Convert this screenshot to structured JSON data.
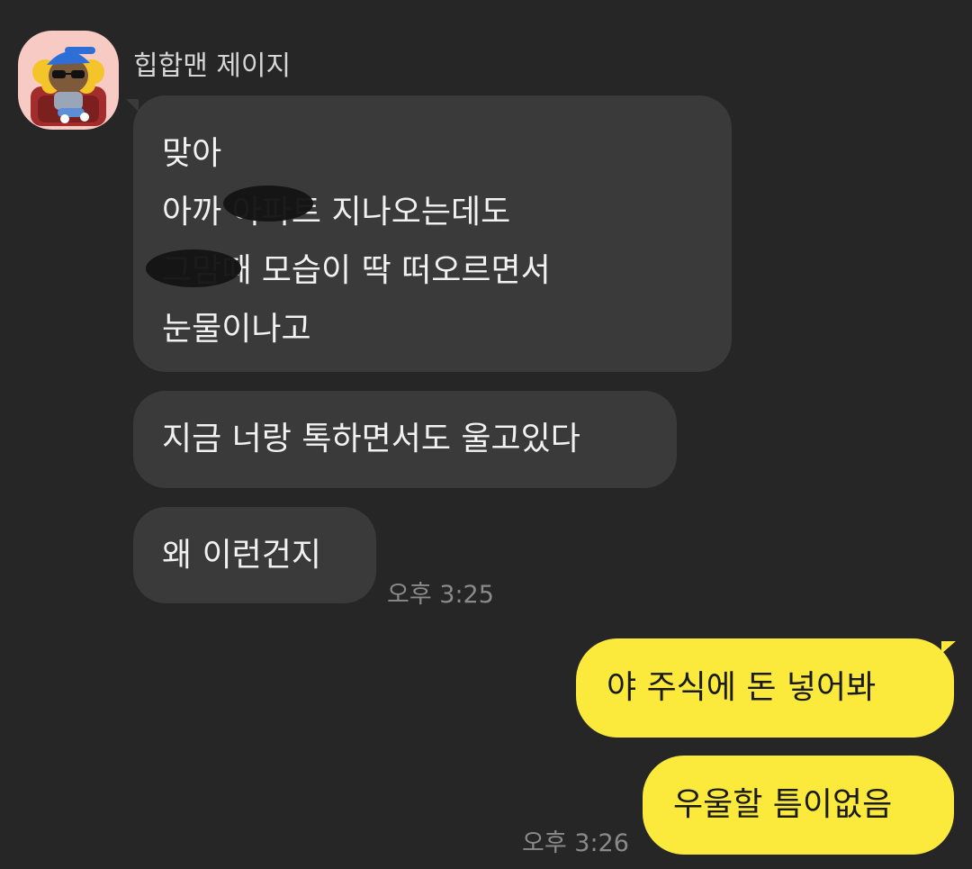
{
  "chat": {
    "sender_name": "힙합맨 제이지",
    "incoming": [
      {
        "lines": [
          "맞아",
          "아까 아파트 지나오는데도",
          "그맘때 모습이 딱 떠오르면서",
          "눈물이나고"
        ]
      },
      {
        "lines": [
          "지금 너랑 톡하면서도 울고있다"
        ]
      },
      {
        "lines": [
          "왜 이런건지"
        ],
        "time": "오후 3:25"
      }
    ],
    "outgoing": [
      {
        "lines": [
          "야 주식에 돈 넣어봐"
        ]
      },
      {
        "lines": [
          "우울할 틈이없음"
        ],
        "time": "오후 3:26"
      }
    ]
  },
  "colors": {
    "background": "#262626",
    "incoming_bubble": "#3a3a3a",
    "outgoing_bubble": "#fbea3c",
    "timestamp": "#8a8a8a"
  },
  "icons": {
    "avatar": "character-avatar-icon"
  }
}
